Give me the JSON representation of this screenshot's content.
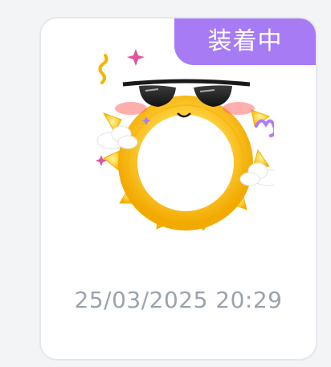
{
  "card": {
    "badge_label": "装着中",
    "timestamp": "25/03/2025 20:29",
    "image_alt": "sun-frame-with-sunglasses"
  },
  "colors": {
    "badge": "#a77bf4",
    "timestamp": "#9aa3ad",
    "card_border": "#e5e7eb",
    "sun_yellow": "#ffd23f"
  }
}
